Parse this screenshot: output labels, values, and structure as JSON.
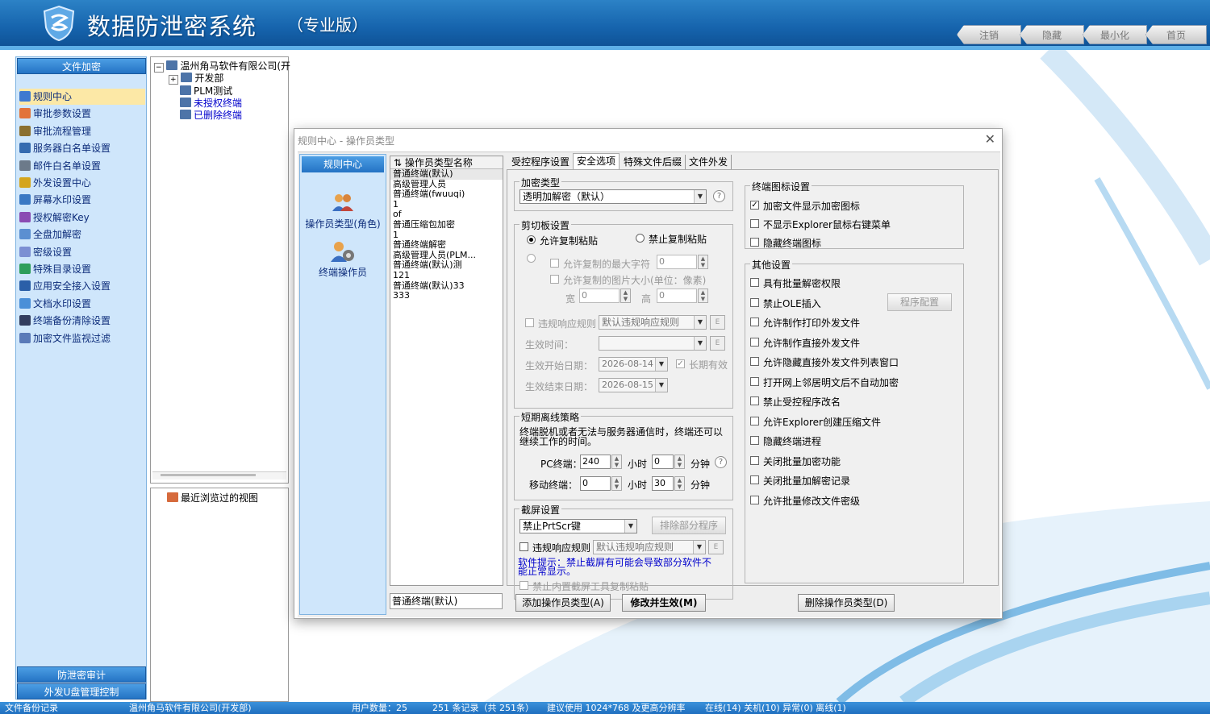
{
  "app": {
    "title": "数据防泄密系统",
    "edition": "（专业版）",
    "window_buttons": [
      "注销",
      "隐藏",
      "最小化",
      "首页"
    ]
  },
  "sidebar": {
    "top_header": "文件加密",
    "items": [
      {
        "label": "规则中心",
        "icon": "rules-icon",
        "selected": true
      },
      {
        "label": "审批参数设置",
        "icon": "approval-params-icon"
      },
      {
        "label": "审批流程管理",
        "icon": "approval-flow-icon"
      },
      {
        "label": "服务器白名单设置",
        "icon": "server-whitelist-icon"
      },
      {
        "label": "邮件白名单设置",
        "icon": "mail-whitelist-icon"
      },
      {
        "label": "外发设置中心",
        "icon": "outgoing-icon"
      },
      {
        "label": "屏幕水印设置",
        "icon": "screen-watermark-icon"
      },
      {
        "label": "授权解密Key",
        "icon": "key-icon"
      },
      {
        "label": "全盘加解密",
        "icon": "disk-icon"
      },
      {
        "label": "密级设置",
        "icon": "secret-level-icon"
      },
      {
        "label": "特殊目录设置",
        "icon": "special-dir-icon"
      },
      {
        "label": "应用安全接入设置",
        "icon": "app-access-icon"
      },
      {
        "label": "文档水印设置",
        "icon": "doc-watermark-icon"
      },
      {
        "label": "终端备份清除设置",
        "icon": "backup-clear-icon"
      },
      {
        "label": "加密文件监视过滤",
        "icon": "monitor-filter-icon"
      }
    ],
    "bottom_headers": [
      "防泄密审计",
      "外发U盘管理控制"
    ]
  },
  "tree": {
    "root": "温州角马软件有限公司(开",
    "children": [
      "开发部",
      "PLM测试",
      "未授权终端",
      "已删除终端"
    ]
  },
  "recent": {
    "label": "最近浏览过的视图"
  },
  "dialog": {
    "title": "规则中心 - 操作员类型",
    "nav": {
      "header": "规则中心",
      "items": [
        "操作员类型(角色)",
        "终端操作员"
      ]
    },
    "type_list": {
      "header": "操作员类型名称",
      "items": [
        "普通终端(默认)",
        "高级管理人员",
        "普通终端(fwuuqi)",
        "1",
        "of",
        "普通压缩包加密",
        "1",
        "普通终端解密",
        "高级管理人员(PLM...",
        "普通终端(默认)测",
        "121",
        "普通终端(默认)33",
        "333"
      ],
      "current": "普通终端(默认)"
    },
    "tabs": [
      "受控程序设置",
      "安全选项",
      "特殊文件后缀",
      "文件外发"
    ],
    "active_tab": 1,
    "encrypt": {
      "group": "加密类型",
      "value": "透明加解密（默认）"
    },
    "clipboard": {
      "group": "剪切板设置",
      "allow": "允许复制粘贴",
      "forbid": "禁止复制粘贴",
      "max_chars_label": "允许复制的最大字符",
      "max_chars": "0",
      "img_size_label": "允许复制的图片大小(单位：像素)",
      "width_label": "宽",
      "width": "0",
      "height_label": "高",
      "height": "0",
      "violation_label": "违规响应规则",
      "violation_value": "默认违规响应规则",
      "effective_time_label": "生效时间：",
      "start_date_label": "生效开始日期：",
      "start_date": "2026-08-14",
      "long_term": "长期有效",
      "end_date_label": "生效结束日期：",
      "end_date": "2026-08-15",
      "e_button": "E"
    },
    "offline": {
      "group": "短期离线策略",
      "desc": "终端脱机或者无法与服务器通信时，终端还可以继续工作的时间。",
      "pc_label": "PC终端：",
      "pc_hours": "240",
      "pc_minutes": "0",
      "mobile_label": "移动终端：",
      "mobile_hours": "0",
      "mobile_minutes": "30",
      "hour_unit": "小时",
      "minute_unit": "分钟"
    },
    "screenshot": {
      "group": "截屏设置",
      "value": "禁止PrtScr键",
      "exclude_button": "排除部分程序",
      "violation_label": "违规响应规则",
      "violation_value": "默认违规响应规则",
      "hint": "软件提示：禁止截屏有可能会导致部分软件不能正常显示。",
      "forbid_builtin": "禁止内置截屏工具复制粘贴"
    },
    "icon_settings": {
      "group": "终端图标设置",
      "items": [
        {
          "label": "加密文件显示加密图标",
          "checked": true
        },
        {
          "label": "不显示Explorer鼠标右键菜单",
          "checked": false
        },
        {
          "label": "隐藏终端图标",
          "checked": false
        }
      ]
    },
    "other_settings": {
      "group": "其他设置",
      "program_config_button": "程序配置",
      "items": [
        {
          "label": "具有批量解密权限",
          "checked": false
        },
        {
          "label": "禁止OLE插入",
          "checked": false
        },
        {
          "label": "允许制作打印外发文件",
          "checked": false
        },
        {
          "label": "允许制作直接外发文件",
          "checked": false
        },
        {
          "label": "允许隐藏直接外发文件列表窗口",
          "checked": false
        },
        {
          "label": "打开网上邻居明文后不自动加密",
          "checked": false
        },
        {
          "label": "禁止受控程序改名",
          "checked": false
        },
        {
          "label": "允许Explorer创建压缩文件",
          "checked": false
        },
        {
          "label": "隐藏终端进程",
          "checked": false
        },
        {
          "label": "关闭批量加密功能",
          "checked": false
        },
        {
          "label": "关闭批量加解密记录",
          "checked": false
        },
        {
          "label": "允许批量修改文件密级",
          "checked": false
        }
      ]
    },
    "buttons": {
      "add": "添加操作员类型(A)",
      "save": "修改并生效(M)",
      "delete": "删除操作员类型(D)"
    }
  },
  "status": {
    "left": "文件备份记录",
    "company": "温州角马软件有限公司(开发部)",
    "users": "用户数量：25",
    "records": "251 条记录（共 251条）",
    "resolution": "建议使用 1024*768 及更高分辨率",
    "online": "在线(14) 关机(10) 异常(0) 离线(1)"
  },
  "colors": {
    "title_bar": "#1664ad",
    "sidebar_bg": "#cfe6fb",
    "sidebar_header": "#2473c4",
    "selected_item": "#fce8a6",
    "link_blue": "#0000cc"
  }
}
